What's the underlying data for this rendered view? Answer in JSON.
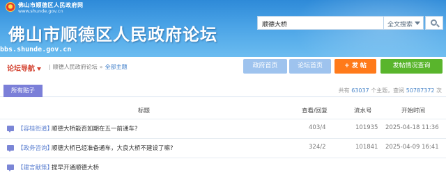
{
  "header": {
    "gov_name": "佛山市顺德区人民政府网",
    "gov_url": "www.shunde.gov.cn",
    "site_title": "佛山市顺德区人民政府论坛",
    "site_url": "bbs.shunde.gov.cn",
    "emblem_icon": "national-emblem-icon"
  },
  "search": {
    "query": "顺德大桥",
    "type_selected": "全文搜索",
    "button_icon": "search-icon"
  },
  "nav": {
    "title": "论坛导航",
    "breadcrumb": [
      "顺德人民政府论坛",
      "全部主题"
    ],
    "buttons": {
      "gov_home": "政府首页",
      "forum_home": "论坛首页",
      "post": "+ 发 帖",
      "query": "发帖情况查询"
    }
  },
  "tabs": {
    "all_posts": "所有贴子"
  },
  "stats": {
    "prefix": "共有",
    "topics": "63037",
    "topics_suffix": "个主题，查阅",
    "views": "50787372",
    "views_suffix": "次"
  },
  "table": {
    "headers": {
      "title": "标题",
      "views": "查看/回复",
      "serial": "流水号",
      "time": "开始时间"
    },
    "rows": [
      {
        "category": "【容桂街道】",
        "subject": "顺德大桥能否如期在五一前通车?",
        "views": "403/4",
        "serial": "101935",
        "time": "2025-04-18 11:36"
      },
      {
        "category": "【政务咨询】",
        "subject": "顺德大桥已经准备通车，大良大桥不建设了嘛?",
        "views": "324/2",
        "serial": "101841",
        "time": "2025-04-09 16:41"
      },
      {
        "category": "【建言献策】",
        "subject": "提早开通顺德大桥",
        "views": "",
        "serial": "",
        "time": ""
      }
    ]
  },
  "colors": {
    "banner": "#3a96de",
    "nav_title": "#d3402e",
    "button_blue": "#9ec3ee",
    "button_orange": "#ff7a1a",
    "button_green": "#59b52c",
    "tab_purple": "#7b7fd8"
  }
}
